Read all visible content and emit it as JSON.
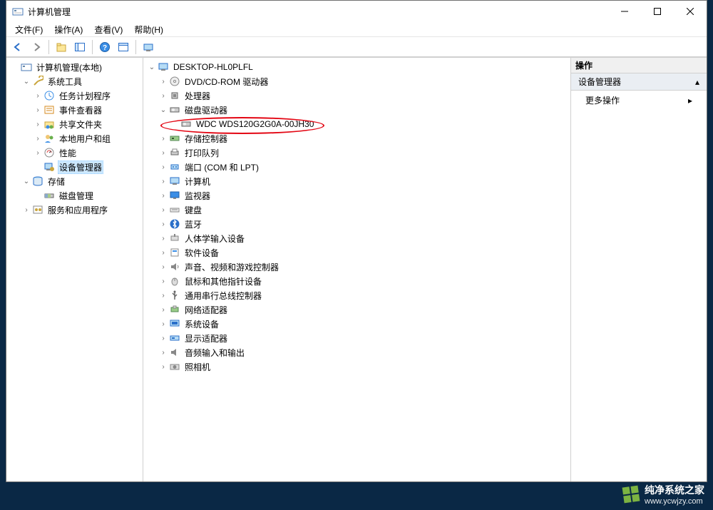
{
  "window": {
    "title": "计算机管理"
  },
  "menu": {
    "file": "文件(F)",
    "action": "操作(A)",
    "view": "查看(V)",
    "help": "帮助(H)"
  },
  "leftTree": {
    "root": "计算机管理(本地)",
    "sysTools": "系统工具",
    "taskScheduler": "任务计划程序",
    "eventViewer": "事件查看器",
    "sharedFolders": "共享文件夹",
    "localUsers": "本地用户和组",
    "performance": "性能",
    "deviceManager": "设备管理器",
    "storage": "存储",
    "diskMgmt": "磁盘管理",
    "servicesApps": "服务和应用程序"
  },
  "centerTree": {
    "root": "DESKTOP-HL0PLFL",
    "dvd": "DVD/CD-ROM 驱动器",
    "processor": "处理器",
    "diskDrives": "磁盘驱动器",
    "wdc": "WDC WDS120G2G0A-00JH30",
    "storageCtrl": "存储控制器",
    "printQueue": "打印队列",
    "ports": "端口 (COM 和 LPT)",
    "computer": "计算机",
    "monitor": "监视器",
    "keyboard": "键盘",
    "bluetooth": "蓝牙",
    "hid": "人体学输入设备",
    "softDevices": "软件设备",
    "audio": "声音、视频和游戏控制器",
    "mouse": "鼠标和其他指针设备",
    "usb": "通用串行总线控制器",
    "network": "网络适配器",
    "sysDevices": "系统设备",
    "display": "显示适配器",
    "audioIO": "音频输入和输出",
    "camera": "照相机"
  },
  "rightPanel": {
    "header": "操作",
    "section": "设备管理器",
    "moreActions": "更多操作"
  },
  "watermark": {
    "name": "纯净系统之家",
    "url": "www.ycwjzy.com"
  }
}
